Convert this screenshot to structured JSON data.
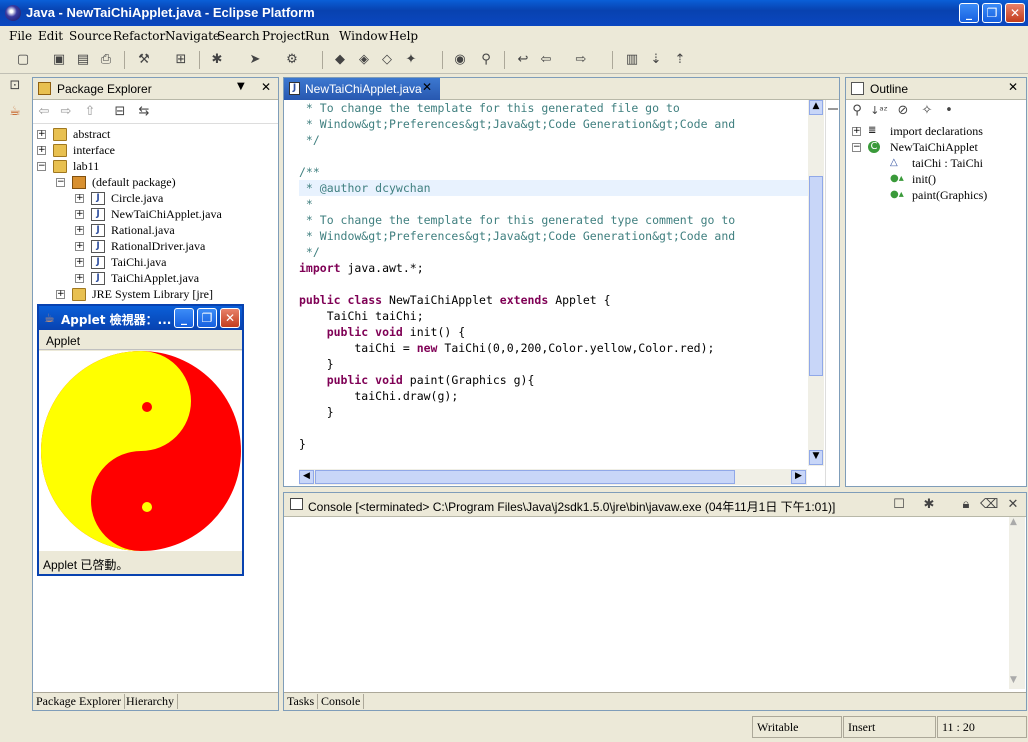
{
  "window": {
    "title": "Java - NewTaiChiApplet.java - Eclipse Platform"
  },
  "menu": [
    "File",
    "Edit",
    "Source",
    "Refactor",
    "Navigate",
    "Search",
    "Project",
    "Run",
    "Window",
    "Help"
  ],
  "package_explorer": {
    "title": "Package Explorer",
    "items": [
      {
        "label": "abstract",
        "type": "folder",
        "level": 0,
        "expander": "+"
      },
      {
        "label": "interface",
        "type": "folder",
        "level": 0,
        "expander": "+"
      },
      {
        "label": "lab11",
        "type": "folder",
        "level": 0,
        "expander": "−"
      },
      {
        "label": "(default package)",
        "type": "package",
        "level": 1,
        "expander": "−"
      },
      {
        "label": "Circle.java",
        "type": "java",
        "level": 2,
        "expander": "+"
      },
      {
        "label": "NewTaiChiApplet.java",
        "type": "java",
        "level": 2,
        "expander": "+"
      },
      {
        "label": "Rational.java",
        "type": "java",
        "level": 2,
        "expander": "+"
      },
      {
        "label": "RationalDriver.java",
        "type": "java",
        "level": 2,
        "expander": "+"
      },
      {
        "label": "TaiChi.java",
        "type": "java",
        "level": 2,
        "expander": "+"
      },
      {
        "label": "TaiChiApplet.java",
        "type": "java",
        "level": 2,
        "expander": "+"
      },
      {
        "label": "JRE System Library [jre]",
        "type": "library",
        "level": 1,
        "expander": "+"
      }
    ],
    "tabs": [
      "Package Explorer",
      "Hierarchy"
    ]
  },
  "editor": {
    "tab": "NewTaiChiApplet.java",
    "lines": [
      {
        "t": "cm",
        "s": " * To change the template for this generated file go to"
      },
      {
        "t": "cm",
        "s": " * Window&gt;Preferences&gt;Java&gt;Code Generation&gt;Code and"
      },
      {
        "t": "cm",
        "s": " */"
      },
      {
        "t": "",
        "s": ""
      },
      {
        "t": "cm",
        "s": "/**"
      },
      {
        "t": "cm",
        "s": " * @author dcywchan"
      },
      {
        "t": "cm",
        "s": " *"
      },
      {
        "t": "cm",
        "s": " * To change the template for this generated type comment go to"
      },
      {
        "t": "cm",
        "s": " * Window&gt;Preferences&gt;Java&gt;Code Generation&gt;Code and"
      },
      {
        "t": "cm",
        "s": " */"
      },
      {
        "t": "mix",
        "parts": [
          [
            "kw",
            "import"
          ],
          [
            "",
            "java.awt.*;"
          ]
        ]
      },
      {
        "t": "",
        "s": ""
      },
      {
        "t": "mix",
        "parts": [
          [
            "kw",
            "public class"
          ],
          [
            "",
            "NewTaiChiApplet"
          ],
          [
            "kw",
            "extends"
          ],
          [
            "",
            "Applet {"
          ]
        ]
      },
      {
        "t": "",
        "s": "    TaiChi taiChi;"
      },
      {
        "t": "mix",
        "parts": [
          [
            "kw",
            "    public void"
          ],
          [
            "",
            "init() {"
          ]
        ]
      },
      {
        "t": "mix",
        "parts": [
          [
            "",
            "        taiChi ="
          ],
          [
            "kw",
            "new"
          ],
          [
            "",
            "TaiChi(0,0,200,Color.yellow,Color.red);"
          ]
        ]
      },
      {
        "t": "",
        "s": "    }"
      },
      {
        "t": "mix",
        "parts": [
          [
            "kw",
            "    public void"
          ],
          [
            "",
            "paint(Graphics g){"
          ]
        ]
      },
      {
        "t": "",
        "s": "        taiChi.draw(g);"
      },
      {
        "t": "",
        "s": "    }"
      },
      {
        "t": "",
        "s": ""
      },
      {
        "t": "",
        "s": "}"
      }
    ]
  },
  "outline": {
    "title": "Outline",
    "items": [
      {
        "label": "import declarations",
        "level": 0,
        "expander": "+"
      },
      {
        "label": "NewTaiChiApplet",
        "level": 0,
        "expander": "−"
      },
      {
        "label": "taiChi : TaiChi",
        "level": 1
      },
      {
        "label": "init()",
        "level": 1
      },
      {
        "label": "paint(Graphics)",
        "level": 1
      }
    ]
  },
  "console": {
    "title": "Console [<terminated> C:\\Program Files\\Java\\j2sdk1.5.0\\jre\\bin\\javaw.exe (04年11月1日 下午1:01)]",
    "tabs": [
      "Tasks",
      "Console"
    ]
  },
  "applet_window": {
    "title": "Applet 檢視器：...",
    "menu": "Applet",
    "status": "Applet 已啓動。",
    "colors": {
      "yin": "#ffff00",
      "yang": "#ff0000"
    }
  },
  "status_bar": {
    "mode": "Writable",
    "insert": "Insert",
    "position": "11 : 20"
  }
}
